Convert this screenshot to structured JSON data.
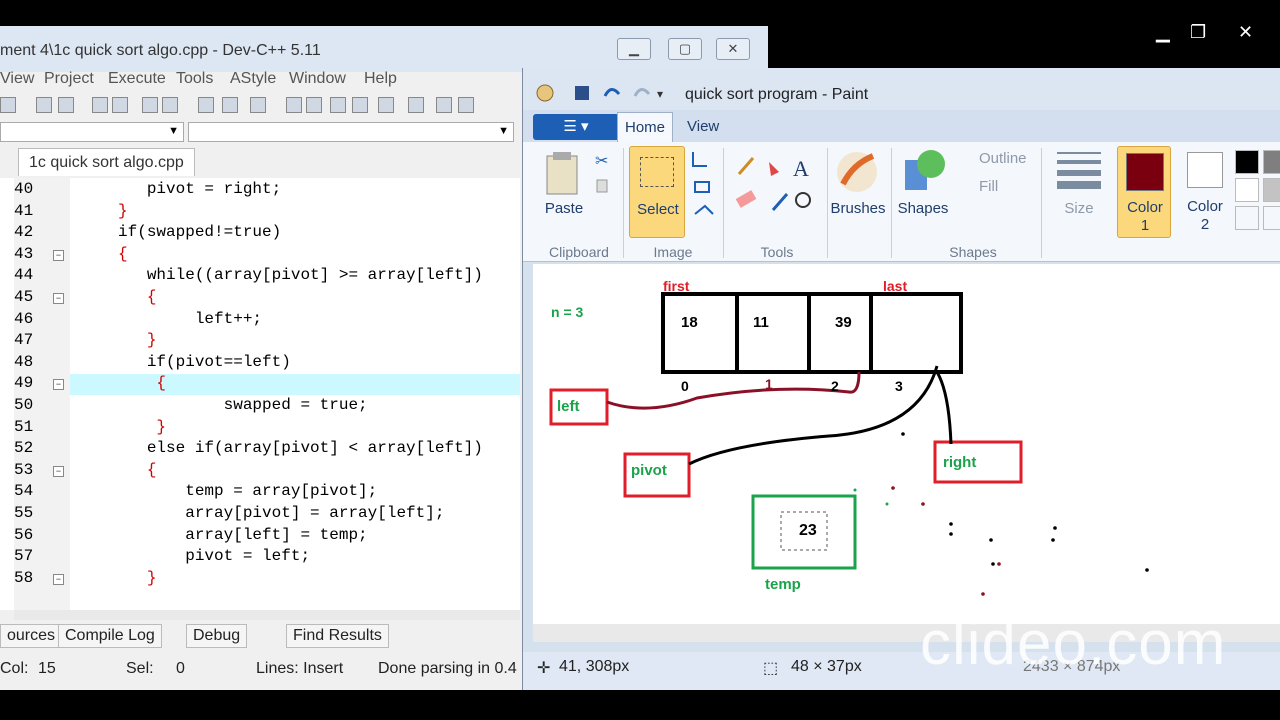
{
  "top_controls": {
    "min": "▁",
    "restore": "❐",
    "close": "✕"
  },
  "devcpp": {
    "title": "ment 4\\1c quick sort algo.cpp - Dev-C++ 5.11",
    "menu": [
      "View",
      "Project",
      "Execute",
      "Tools",
      "AStyle",
      "Window",
      "Help"
    ],
    "tab": "1c quick sort algo.cpp",
    "lines": [
      {
        "n": "40",
        "code": [
          {
            "t": "        pivot = right;",
            "c": ""
          }
        ]
      },
      {
        "n": "41",
        "code": [
          {
            "t": "     }",
            "c": "op"
          }
        ]
      },
      {
        "n": "42",
        "code": [
          {
            "t": "     if(swapped!=true)",
            "c": ""
          }
        ]
      },
      {
        "n": "43",
        "code": [
          {
            "t": "     {",
            "c": "op"
          }
        ]
      },
      {
        "n": "44",
        "code": [
          {
            "t": "        while((array[pivot] >= array[left])",
            "c": ""
          }
        ]
      },
      {
        "n": "45",
        "code": [
          {
            "t": "        {",
            "c": "op"
          }
        ]
      },
      {
        "n": "46",
        "code": [
          {
            "t": "             left++;",
            "c": ""
          }
        ]
      },
      {
        "n": "47",
        "code": [
          {
            "t": "        }",
            "c": "op"
          }
        ]
      },
      {
        "n": "48",
        "code": [
          {
            "t": "        if(pivot==left)",
            "c": ""
          }
        ]
      },
      {
        "n": "49",
        "code": [
          {
            "t": "         {",
            "c": "op"
          }
        ]
      },
      {
        "n": "50",
        "code": [
          {
            "t": "                swapped = true;",
            "c": ""
          }
        ]
      },
      {
        "n": "51",
        "code": [
          {
            "t": "         }",
            "c": "op"
          }
        ]
      },
      {
        "n": "52",
        "code": [
          {
            "t": "        else if(array[pivot] < array[left])",
            "c": ""
          }
        ]
      },
      {
        "n": "53",
        "code": [
          {
            "t": "        {",
            "c": "op"
          }
        ]
      },
      {
        "n": "54",
        "code": [
          {
            "t": "            temp = array[pivot];",
            "c": ""
          }
        ]
      },
      {
        "n": "55",
        "code": [
          {
            "t": "            array[pivot] = array[left];",
            "c": ""
          }
        ]
      },
      {
        "n": "56",
        "code": [
          {
            "t": "            array[left] = temp;",
            "c": ""
          }
        ]
      },
      {
        "n": "57",
        "code": [
          {
            "t": "            pivot = left;",
            "c": ""
          }
        ]
      },
      {
        "n": "58",
        "code": [
          {
            "t": "        }",
            "c": "op"
          }
        ]
      }
    ],
    "bottom_tabs": [
      "ources",
      "Compile Log",
      "Debug",
      "Find Results"
    ],
    "status": {
      "col_label": "Col:",
      "col": "15",
      "sel_label": "Sel:",
      "sel": "0",
      "lines": "Lines: Insert",
      "parse": "Done parsing in 0.4"
    }
  },
  "paint": {
    "title": "quick sort program - Paint",
    "file_button": "☰ ▾",
    "tabs": {
      "home": "Home",
      "view": "View"
    },
    "ribbon": {
      "paste": "Paste",
      "select": "Select",
      "brushes": "Brushes",
      "shapes": "Shapes",
      "outline": "Outline",
      "fill": "Fill",
      "size": "Size",
      "color1": "Color\n1",
      "color2": "Color\n2",
      "groups": {
        "clipboard": "Clipboard",
        "image": "Image",
        "tools": "Tools",
        "shapes": "Shapes"
      }
    },
    "colors": {
      "color1": "#7a0010",
      "color2": "#ffffff",
      "palette": [
        "#000000",
        "#7f7f7f",
        "#ffffff",
        "#c3c3c3"
      ]
    },
    "canvas": {
      "n_label": "n = 3",
      "first": "first",
      "last": "last",
      "cells": [
        "18",
        "11",
        "39",
        ""
      ],
      "indices": [
        "0",
        "1",
        "2",
        "3"
      ],
      "left": "left",
      "pivot": "pivot",
      "right": "right",
      "temp_value": "23",
      "temp_label": "temp"
    },
    "status": {
      "pos": "41, 308px",
      "size": "48 × 37px",
      "image_size": "2433 × 874px"
    }
  },
  "watermark": "clideo.com"
}
